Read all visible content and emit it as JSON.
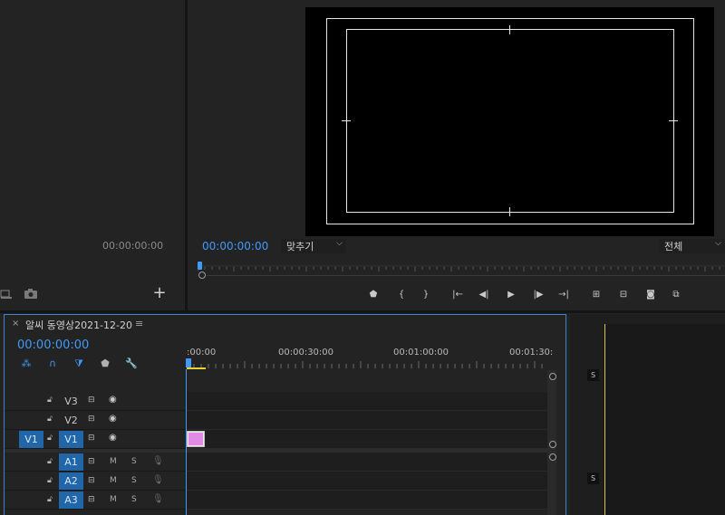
{
  "source": {
    "timecode": "00:00:00:00",
    "add_label": "+"
  },
  "program": {
    "timecode": "00:00:00:00",
    "zoom": "맞추기",
    "quality": "전체"
  },
  "transport": [
    {
      "name": "add-marker-button",
      "glyph": "⬟"
    },
    {
      "name": "mark-in-button",
      "glyph": "{"
    },
    {
      "name": "mark-out-button",
      "glyph": "}"
    },
    {
      "name": "go-to-in-button",
      "glyph": "|←"
    },
    {
      "name": "step-back-button",
      "glyph": "◀|"
    },
    {
      "name": "play-button",
      "glyph": "▶"
    },
    {
      "name": "step-forward-button",
      "glyph": "|▶"
    },
    {
      "name": "go-to-out-button",
      "glyph": "→|"
    },
    {
      "name": "lift-button",
      "glyph": "⊞"
    },
    {
      "name": "extract-button",
      "glyph": "⊟"
    },
    {
      "name": "export-frame-button",
      "glyph": "◙"
    },
    {
      "name": "compare-view-button",
      "glyph": "⧉"
    }
  ],
  "timeline": {
    "close": "×",
    "title": "알씨 동영상2021-12-20",
    "menu": "≡",
    "timecode": "00:00:00:00",
    "ruler": [
      ":00:00",
      "00:00:30:00",
      "00:01:00:00",
      "00:01:30:"
    ],
    "tools": [
      {
        "name": "nest-sequence-icon",
        "glyph": "⁂",
        "color": "blue"
      },
      {
        "name": "snap-magnet-icon",
        "glyph": "∩",
        "color": "blue"
      },
      {
        "name": "linked-selection-icon",
        "glyph": "⧩",
        "color": "blue"
      },
      {
        "name": "add-marker-icon",
        "glyph": "⬟",
        "color": "grey"
      },
      {
        "name": "wrench-icon",
        "glyph": "🔧",
        "color": "grey"
      }
    ],
    "video_tracks": [
      {
        "label": "V3",
        "source": "",
        "active": false
      },
      {
        "label": "V2",
        "source": "",
        "active": false
      },
      {
        "label": "V1",
        "source": "V1",
        "active": true
      }
    ],
    "audio_tracks": [
      {
        "label": "A1",
        "active": true,
        "m": "M",
        "s": "S"
      },
      {
        "label": "A2",
        "active": true,
        "m": "M",
        "s": "S"
      },
      {
        "label": "A3",
        "active": true,
        "m": "M",
        "s": "S"
      }
    ]
  },
  "right_panel": {
    "badges": [
      "S",
      "S"
    ]
  },
  "colors": {
    "accent": "#3f9af8",
    "track_target": "#2066a8",
    "clip": "#e28be6",
    "work_area": "#e8d23a"
  }
}
